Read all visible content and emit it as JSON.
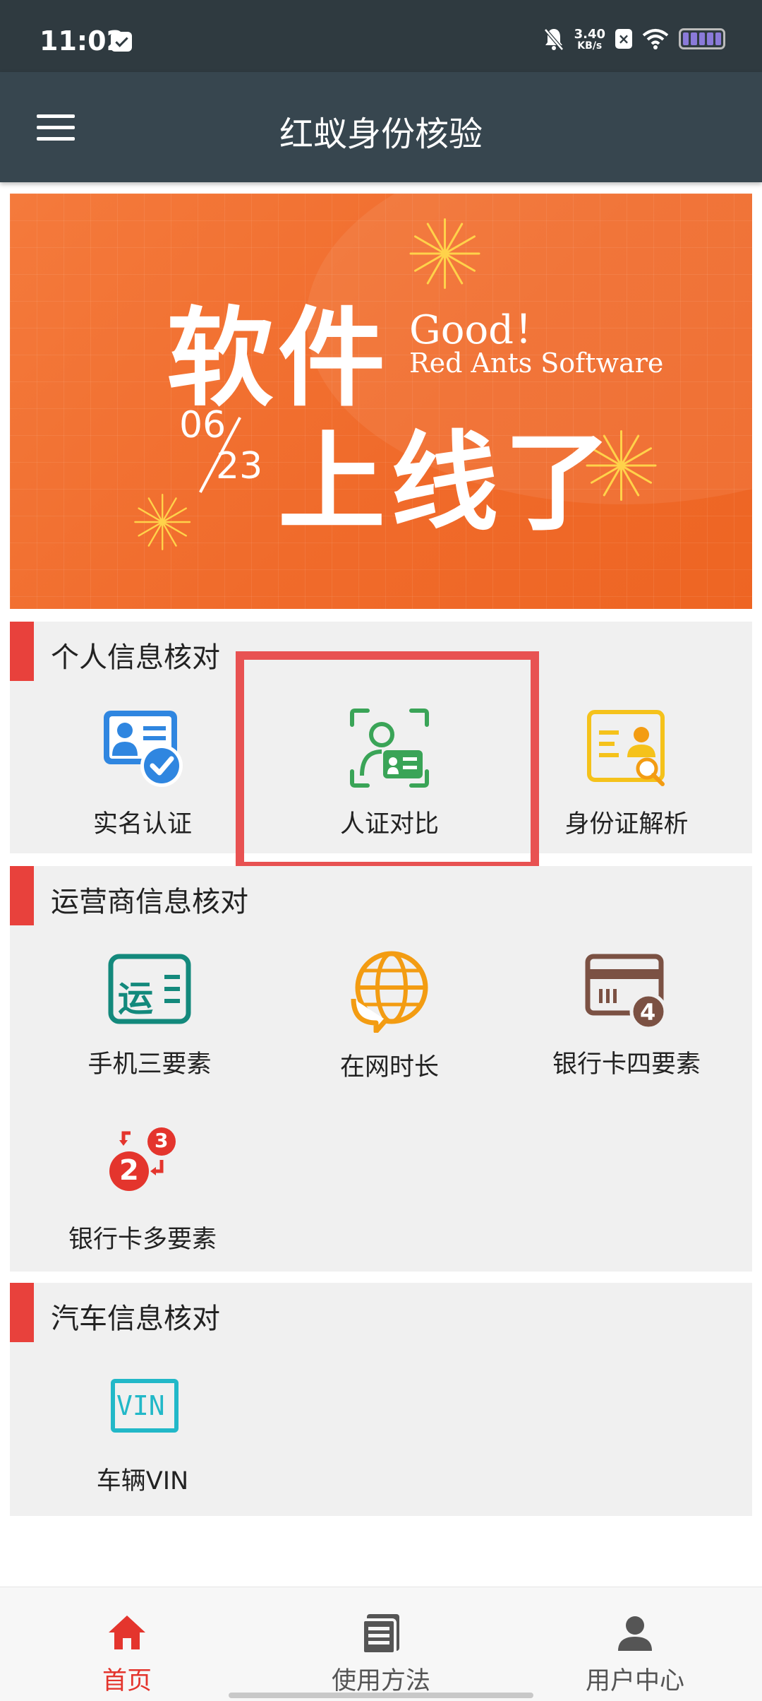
{
  "status_bar": {
    "time": "11:02",
    "net_speed_value": "3.40",
    "net_speed_unit": "KB/s"
  },
  "app_bar": {
    "title": "红蚁身份核验"
  },
  "banner": {
    "headline_1": "软件",
    "headline_2": "上线了",
    "good": "Good！",
    "brand": "Red Ants Software",
    "date_month": "06",
    "date_day": "23"
  },
  "sections": {
    "personal": {
      "title": "个人信息核对",
      "items": [
        {
          "label": "实名认证",
          "icon": "id-card-check-icon"
        },
        {
          "label": "人证对比",
          "icon": "face-id-compare-icon"
        },
        {
          "label": "身份证解析",
          "icon": "id-card-search-icon"
        }
      ]
    },
    "carrier": {
      "title": "运营商信息核对",
      "items": [
        {
          "label": "手机三要素",
          "icon": "carrier-card-icon",
          "badge": "运"
        },
        {
          "label": "在网时长",
          "icon": "globe-chat-icon"
        },
        {
          "label": "银行卡四要素",
          "icon": "bank-card-four-icon",
          "badge": "4"
        },
        {
          "label": "银行卡多要素",
          "icon": "bank-card-multi-icon",
          "badge_a": "2",
          "badge_b": "3"
        }
      ]
    },
    "vehicle": {
      "title": "汽车信息核对",
      "items": [
        {
          "label": "车辆VIN",
          "icon": "vin-icon",
          "badge": "VIN"
        }
      ]
    }
  },
  "bottom_nav": {
    "items": [
      {
        "label": "首页",
        "icon": "home-icon",
        "active": true
      },
      {
        "label": "使用方法",
        "icon": "document-list-icon",
        "active": false
      },
      {
        "label": "用户中心",
        "icon": "user-icon",
        "active": false
      }
    ]
  },
  "colors": {
    "status_bar": "#2f3a40",
    "app_bar": "#37464f",
    "accent_red": "#e8413c",
    "banner_orange": "#f06b2b",
    "section_bg": "#f0f0f0",
    "icon_blue": "#2f86e0",
    "icon_green": "#3aa457",
    "icon_yellow": "#f5c21b",
    "icon_teal": "#13897c",
    "icon_orange": "#f39c12",
    "icon_brown": "#7b5143",
    "icon_cyan": "#22b8c8",
    "highlight_box": "#e85252"
  }
}
